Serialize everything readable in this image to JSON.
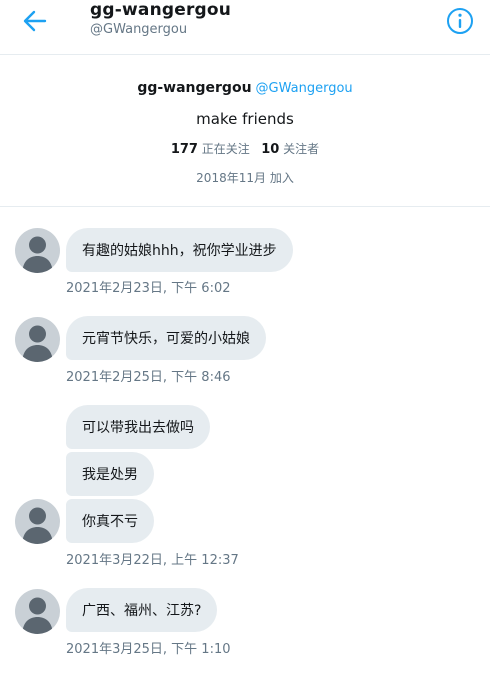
{
  "header": {
    "title": "gg-wangergou",
    "handle": "@GWangergou",
    "back_icon": "arrow-left-icon",
    "info_icon": "info-circle-icon",
    "accent": "#1da1f2"
  },
  "profile": {
    "name": "gg-wangergou",
    "handle": "@GWangergou",
    "bio": "make friends",
    "following_count": "177",
    "following_label": "正在关注",
    "followers_count": "10",
    "followers_label": "关注者",
    "joined_date": "2018年11月",
    "joined_label": "加入"
  },
  "messages": [
    {
      "text": "有趣的姑娘hhh，祝你学业进步",
      "timestamp": "2021年2月23日, 下午 6:02"
    },
    {
      "text": "元宵节快乐，可爱的小姑娘",
      "timestamp": "2021年2月25日, 下午 8:46"
    },
    {
      "text": "可以带我出去做吗"
    },
    {
      "text": "我是处男"
    },
    {
      "text": "你真不亏",
      "timestamp": "2021年3月22日, 上午 12:37"
    },
    {
      "text": "广西、福州、江苏?",
      "timestamp": "2021年3月25日, 下午 1:10"
    }
  ]
}
